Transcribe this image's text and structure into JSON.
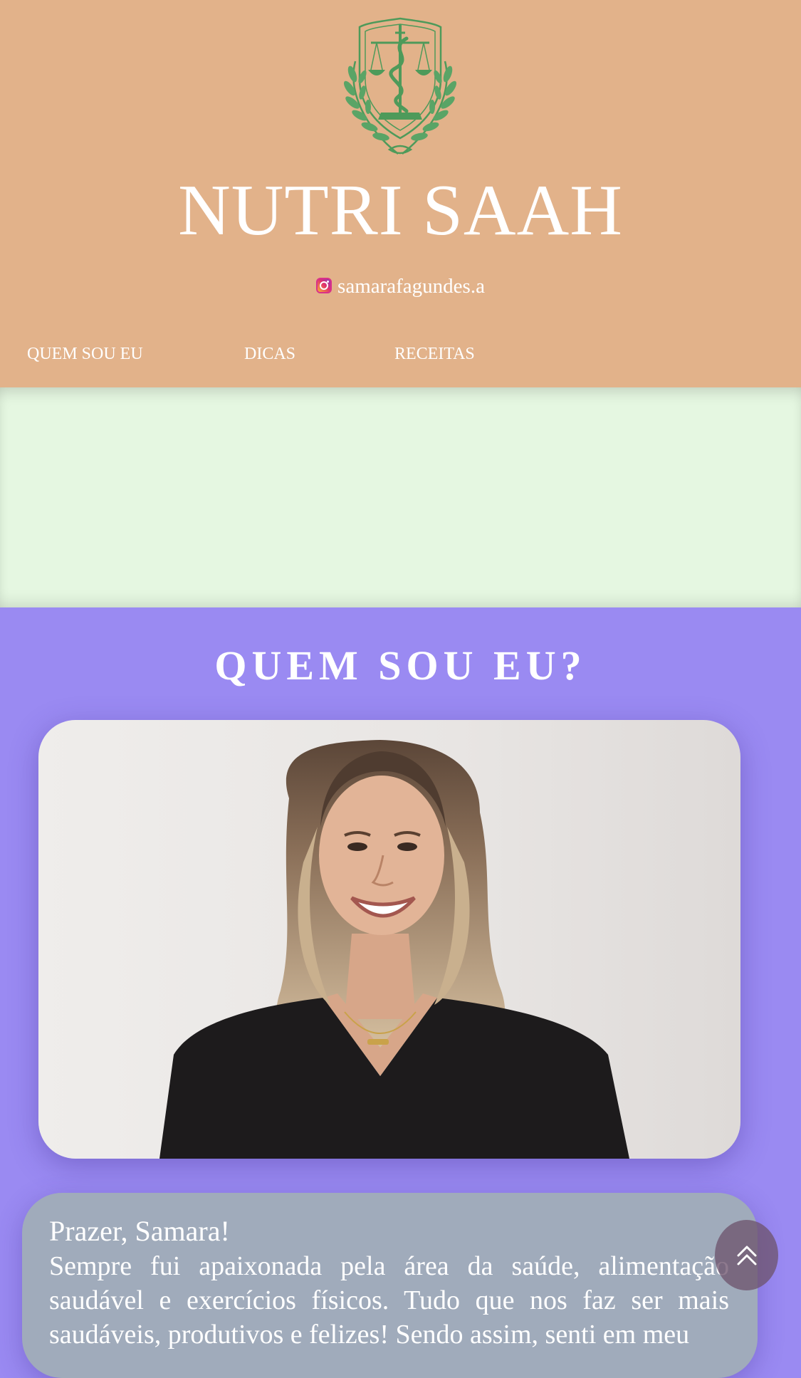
{
  "header": {
    "brand_title": "NUTRI SAAH",
    "logo_icon": "caduceus-scales-laurel-emblem",
    "instagram": {
      "icon": "instagram-icon",
      "handle": "samarafagundes.a"
    },
    "nav": [
      {
        "label": "QUEM SOU EU"
      },
      {
        "label": "DICAS"
      },
      {
        "label": "RECEITAS"
      }
    ]
  },
  "about": {
    "title": "QUEM SOU EU?",
    "photo": "portrait-smiling-woman-black-blouse",
    "greeting": "Prazer, Samara!",
    "bio": "Sempre fui apaixonada pela área da saúde, alimentação saudável e exercícios físicos. Tudo que nos faz ser mais saudáveis, produtivos e felizes! Sendo assim, senti em meu"
  },
  "scroll_top": {
    "icon": "double-chevron-up-icon"
  },
  "colors": {
    "header_bg": "#e2b28a",
    "banner_bg": "#e5f7e1",
    "about_bg": "#9a8af2",
    "text_card_bg": "#a0abbb",
    "logo_green": "#4e9a5a"
  }
}
